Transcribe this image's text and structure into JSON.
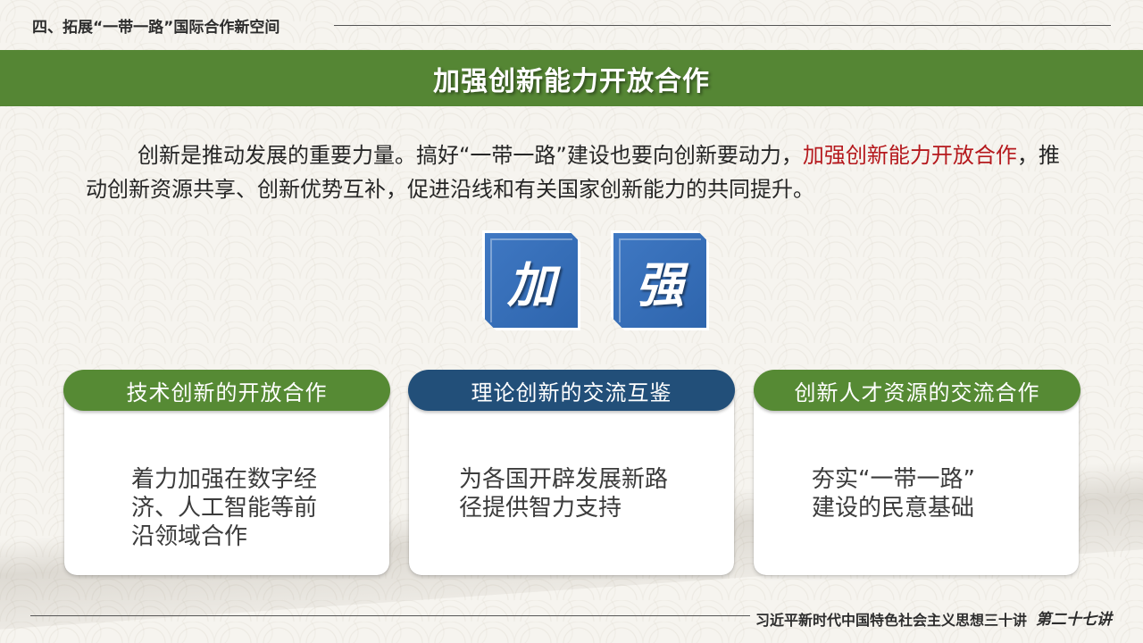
{
  "header": {
    "section_title": "四、拓展“一带一路”国际合作新空间"
  },
  "banner": {
    "title": "加强创新能力开放合作"
  },
  "intro": {
    "part1": "创新是推动发展的重要力量。搞好“一带一路”建设也要向创新要动力，",
    "highlight": "加强创新能力开放合作",
    "part2": "，推动创新资源共享、创新优势互补，促进沿线和有关国家创新能力的共同提升。",
    "highlight_color": "#b5191d"
  },
  "tiles": [
    {
      "char": "加"
    },
    {
      "char": "强"
    }
  ],
  "cards": [
    {
      "title": "技术创新的开放合作",
      "lines": [
        "着力加强在数字经",
        "济、人工智能等前",
        "沿领域合作"
      ],
      "color": "#568a34"
    },
    {
      "title": "理论创新的交流互鉴",
      "lines": [
        "为各国开辟发展新路",
        "径提供智力支持"
      ],
      "color": "#224f79"
    },
    {
      "title": "创新人才资源的交流合作",
      "lines": [
        "夯实“一带一路”",
        "建设的民意基础"
      ],
      "color": "#568a34"
    }
  ],
  "footer": {
    "series_title": "习近平新时代中国特色社会主义思想三十讲",
    "lecture_badge": "第二十七讲"
  }
}
